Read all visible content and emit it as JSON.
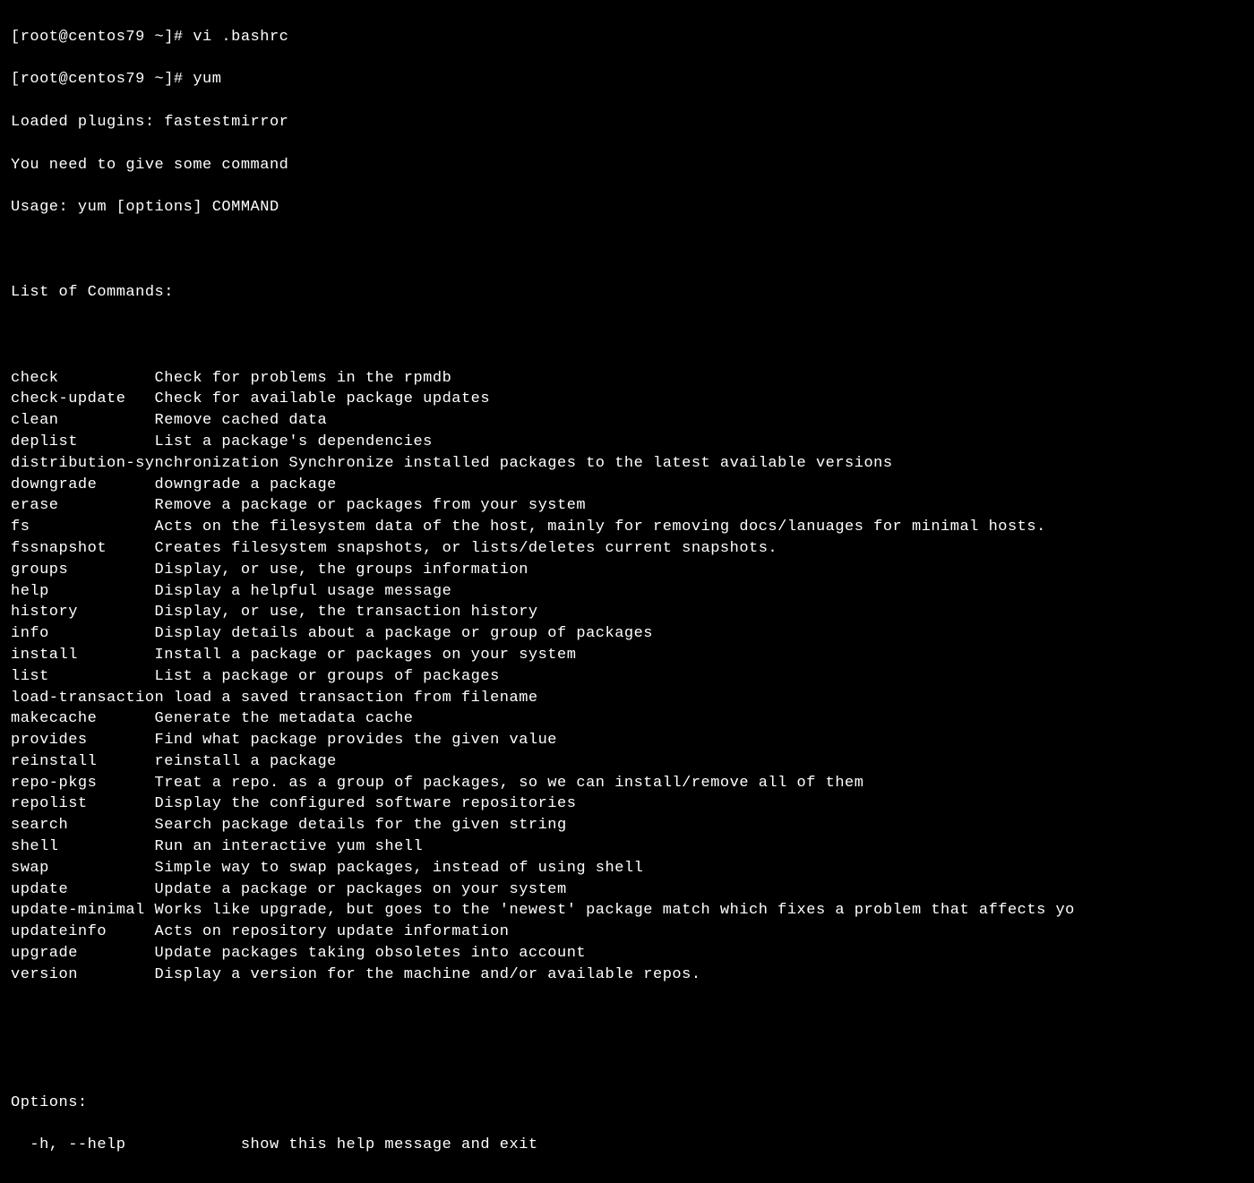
{
  "prompt1": "[root@centos79 ~]# vi .bashrc",
  "prompt2": "[root@centos79 ~]# yum",
  "plugins": "Loaded plugins: fastestmirror",
  "need_cmd": "You need to give some command",
  "usage": "Usage: yum [options] COMMAND",
  "list_header": "List of Commands:",
  "commands": [
    {
      "cmd": "check",
      "desc": "Check for problems in the rpmdb"
    },
    {
      "cmd": "check-update",
      "desc": "Check for available package updates"
    },
    {
      "cmd": "clean",
      "desc": "Remove cached data"
    },
    {
      "cmd": "deplist",
      "desc": "List a package's dependencies"
    },
    {
      "cmd": "distribution-synchronization",
      "desc": "Synchronize installed packages to the latest available versions"
    },
    {
      "cmd": "downgrade",
      "desc": "downgrade a package"
    },
    {
      "cmd": "erase",
      "desc": "Remove a package or packages from your system"
    },
    {
      "cmd": "fs",
      "desc": "Acts on the filesystem data of the host, mainly for removing docs/lanuages for minimal hosts."
    },
    {
      "cmd": "fssnapshot",
      "desc": "Creates filesystem snapshots, or lists/deletes current snapshots."
    },
    {
      "cmd": "groups",
      "desc": "Display, or use, the groups information"
    },
    {
      "cmd": "help",
      "desc": "Display a helpful usage message"
    },
    {
      "cmd": "history",
      "desc": "Display, or use, the transaction history"
    },
    {
      "cmd": "info",
      "desc": "Display details about a package or group of packages"
    },
    {
      "cmd": "install",
      "desc": "Install a package or packages on your system"
    },
    {
      "cmd": "list",
      "desc": "List a package or groups of packages"
    },
    {
      "cmd": "load-transaction",
      "desc": "load a saved transaction from filename"
    },
    {
      "cmd": "makecache",
      "desc": "Generate the metadata cache"
    },
    {
      "cmd": "provides",
      "desc": "Find what package provides the given value"
    },
    {
      "cmd": "reinstall",
      "desc": "reinstall a package"
    },
    {
      "cmd": "repo-pkgs",
      "desc": "Treat a repo. as a group of packages, so we can install/remove all of them"
    },
    {
      "cmd": "repolist",
      "desc": "Display the configured software repositories"
    },
    {
      "cmd": "search",
      "desc": "Search package details for the given string"
    },
    {
      "cmd": "shell",
      "desc": "Run an interactive yum shell"
    },
    {
      "cmd": "swap",
      "desc": "Simple way to swap packages, instead of using shell"
    },
    {
      "cmd": "update",
      "desc": "Update a package or packages on your system"
    },
    {
      "cmd": "update-minimal",
      "desc": "Works like upgrade, but goes to the 'newest' package match which fixes a problem that affects yo"
    },
    {
      "cmd": "updateinfo",
      "desc": "Acts on repository update information"
    },
    {
      "cmd": "upgrade",
      "desc": "Update packages taking obsoletes into account"
    },
    {
      "cmd": "version",
      "desc": "Display a version for the machine and/or available repos."
    }
  ],
  "options_header": "Options:",
  "options": [
    {
      "flag": "  -h, --help",
      "desc": "show this help message and exit"
    }
  ],
  "col_width_cmd": 15,
  "col_width_opt": 24
}
